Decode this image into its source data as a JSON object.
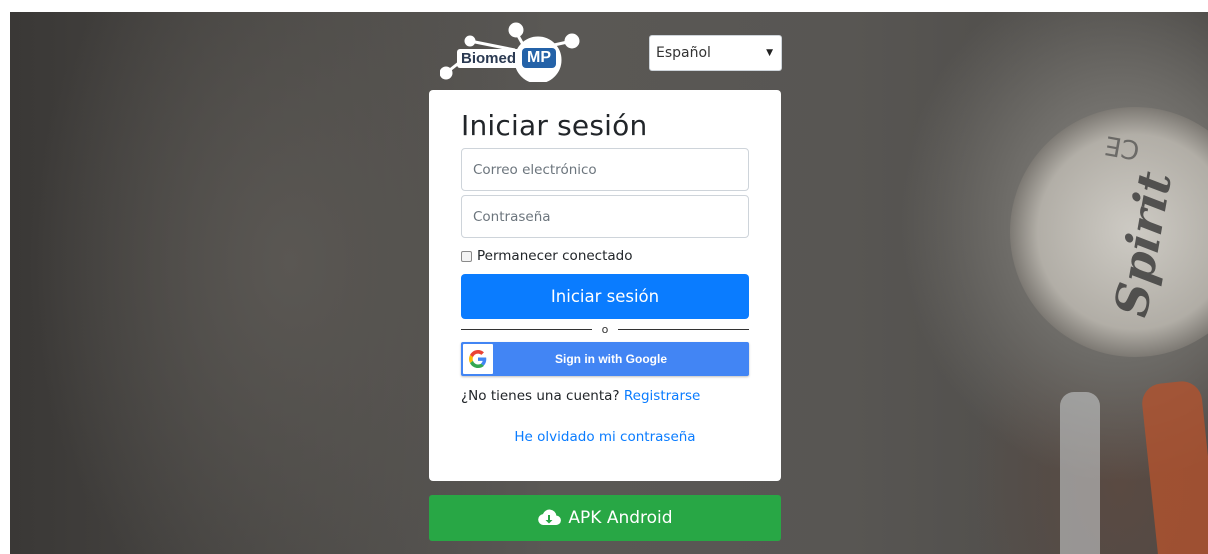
{
  "logo": {
    "part1": "Biomed",
    "part2": "MP"
  },
  "language": {
    "selected": "Español"
  },
  "login": {
    "title": "Iniciar sesión",
    "email_placeholder": "Correo electrónico",
    "password_placeholder": "Contraseña",
    "remember_label": "Permanecer conectado",
    "submit_label": "Iniciar sesión",
    "divider_text": "o",
    "google_label": "Sign in with Google",
    "no_account_text": "¿No tienes una cuenta?",
    "register_link": "Registrarse",
    "forgot_link": "He olvidado mi contraseña"
  },
  "apk": {
    "label": "APK Android",
    "icon": "cloud-download-icon"
  },
  "colors": {
    "primary": "#0a7cff",
    "google": "#4285f4",
    "success": "#28a745",
    "logo_mp": "#2462a8"
  }
}
